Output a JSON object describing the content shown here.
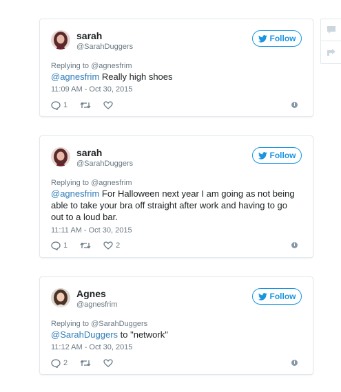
{
  "tweets": [
    {
      "name": "sarah",
      "handle": "@SarahDuggers",
      "follow_label": "Follow",
      "replying_to": "Replying to @agnesfrim",
      "mention": "@agnesfrim",
      "text": " Really high shoes",
      "timestamp": "11:09 AM - Oct 30, 2015",
      "reply_count": "1",
      "like_count": ""
    },
    {
      "name": "sarah",
      "handle": "@SarahDuggers",
      "follow_label": "Follow",
      "replying_to": "Replying to @agnesfrim",
      "mention": "@agnesfrim",
      "text": " For Halloween next year I am going as not being able to take your bra off straight after work and having to go out to a loud bar.",
      "timestamp": "11:11 AM - Oct 30, 2015",
      "reply_count": "1",
      "like_count": "2"
    },
    {
      "name": "Agnes",
      "handle": "@agnesfrim",
      "follow_label": "Follow",
      "replying_to": "Replying to @SarahDuggers",
      "mention": "@SarahDuggers",
      "text": " to \"network\"",
      "timestamp": "11:12 AM - Oct 30, 2015",
      "reply_count": "2",
      "like_count": ""
    }
  ],
  "icons": {
    "reply": "reply-icon",
    "retweet": "retweet-icon",
    "like": "heart-icon",
    "info": "info-icon",
    "bird": "twitter-bird-icon",
    "side_comment": "comment-icon",
    "side_share": "share-icon",
    "info_glyph": "i"
  },
  "colors": {
    "accent": "#1b95e0",
    "mention": "#2b7bb9",
    "muted": "#697882",
    "border": "#e1e8ed"
  }
}
